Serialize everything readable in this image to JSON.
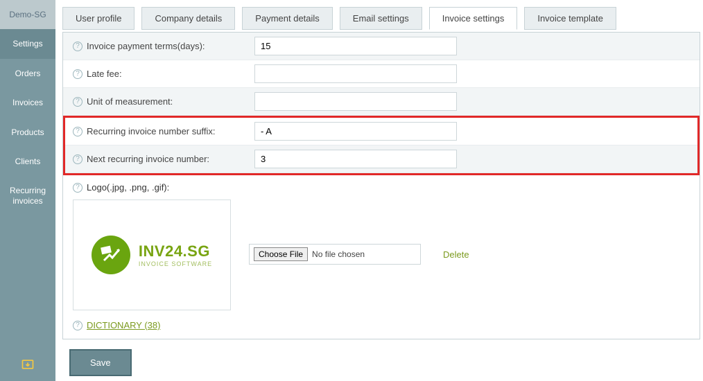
{
  "sidebar": {
    "header": "Demo-SG",
    "items": [
      {
        "label": "Settings",
        "active": true
      },
      {
        "label": "Orders"
      },
      {
        "label": "Invoices"
      },
      {
        "label": "Products"
      },
      {
        "label": "Clients"
      },
      {
        "label": "Recurring invoices"
      }
    ]
  },
  "tabs": [
    {
      "label": "User profile"
    },
    {
      "label": "Company details"
    },
    {
      "label": "Payment details"
    },
    {
      "label": "Email settings"
    },
    {
      "label": "Invoice settings",
      "active": true
    },
    {
      "label": "Invoice template"
    }
  ],
  "form": {
    "payment_terms": {
      "label": "Invoice payment terms(days):",
      "value": "15"
    },
    "late_fee": {
      "label": "Late fee:",
      "value": ""
    },
    "unit": {
      "label": "Unit of measurement:",
      "value": ""
    },
    "suffix": {
      "label": "Recurring invoice number suffix:",
      "value": "- A"
    },
    "next_number": {
      "label": "Next recurring invoice number:",
      "value": "3"
    },
    "logo": {
      "label": "Logo(.jpg, .png, .gif):"
    }
  },
  "logo_brand": {
    "main": "INV24.SG",
    "sub": "INVOICE SOFTWARE"
  },
  "file": {
    "choose": "Choose File",
    "status": "No file chosen",
    "delete": "Delete"
  },
  "dictionary": {
    "label": "DICTIONARY (38)"
  },
  "buttons": {
    "save": "Save"
  }
}
